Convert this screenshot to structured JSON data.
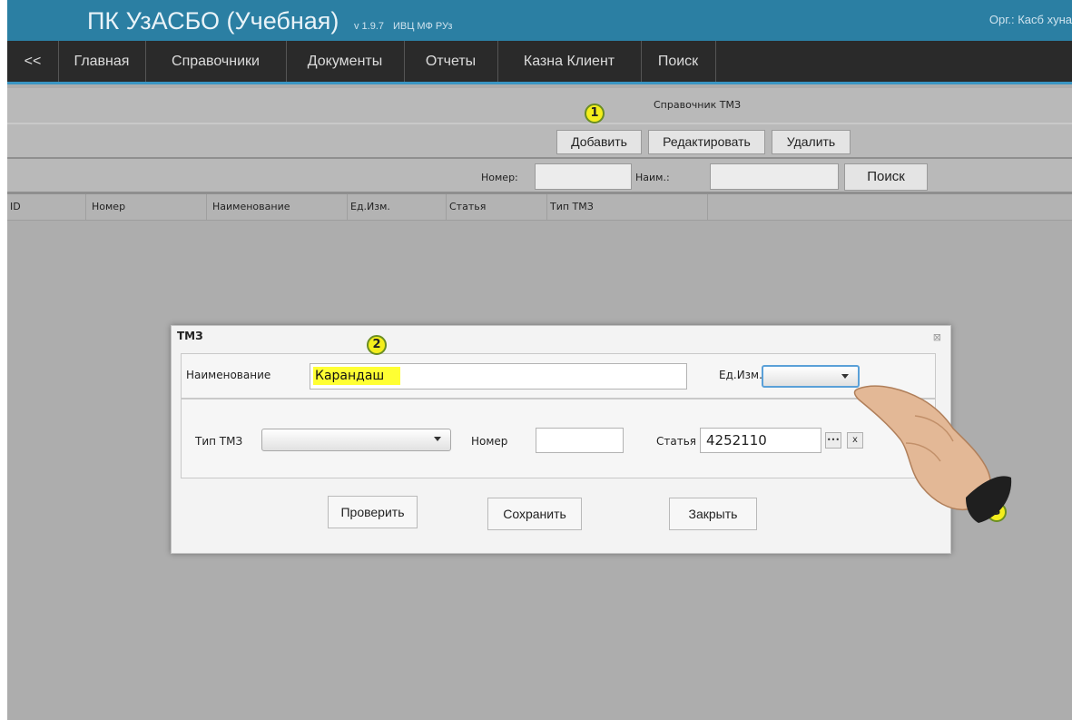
{
  "app": {
    "title": "ПК УзАСБО (Учебная)",
    "version": "v 1.9.7",
    "vendor": "ИВЦ МФ РУз",
    "org": "Орг.: Касб хуна",
    "accent": "#2b7fa3"
  },
  "menu": [
    "<<",
    "Главная",
    "Справочники",
    "Документы",
    "Отчеты",
    "Казна Клиент",
    "Поиск"
  ],
  "page": {
    "title": "Справочник ТМЗ"
  },
  "toolbar": {
    "add": "Добавить",
    "edit": "Редактировать",
    "delete": "Удалить"
  },
  "filter": {
    "number_label": "Номер:",
    "name_label": "Наим.:",
    "search": "Поиск",
    "number_value": "",
    "name_value": ""
  },
  "table": {
    "columns": [
      "ID",
      "Номер",
      "Наименование",
      "Ед.Изм.",
      "Статья",
      "Тип ТМЗ"
    ],
    "rows": []
  },
  "dialog": {
    "title": "ТМЗ",
    "close": "⊠",
    "name_label": "Наименование",
    "name_value": "Карандаш",
    "unit_label": "Ед.Изм.",
    "unit_value": "",
    "type_label": "Тип ТМЗ",
    "type_value": "",
    "number_label": "Номер",
    "number_value": "",
    "article_label": "Статья",
    "article_value": "4252110",
    "ellipsis": "•••",
    "clear": "x",
    "check": "Проверить",
    "save": "Сохранить",
    "close_btn": "Закрыть",
    "highlight_color": "#ffff33"
  },
  "annotations": {
    "step1": "1",
    "step2": "2",
    "step3": "3"
  },
  "pointer": {
    "icon": "hand-pointer-icon"
  }
}
